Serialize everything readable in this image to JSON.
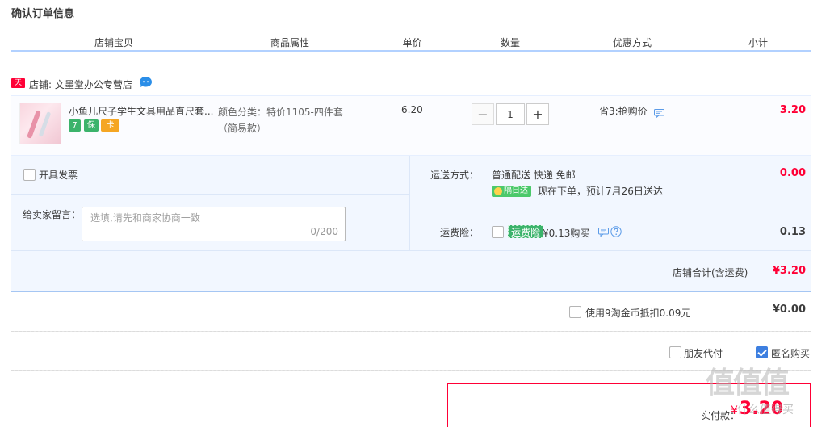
{
  "page_title": "确认订单信息",
  "columns": [
    "店铺宝贝",
    "商品属性",
    "单价",
    "数量",
    "优惠方式",
    "小计"
  ],
  "shop": {
    "badge": "天猫",
    "label": "店铺: 文墨堂办公专营店"
  },
  "item": {
    "title": "小鱼儿尺子学生文具用品直尺套...",
    "service_tags": [
      "7",
      "保",
      "卡"
    ],
    "attr_line1": "颜色分类：特价1105-四件套",
    "attr_line2": "（简易款）",
    "unit_price": "6.20",
    "qty_minus": "−",
    "qty_value": "1",
    "qty_plus": "+",
    "discount": "省3:抢购价",
    "subtotal": "3.20"
  },
  "invoice_label": "开具发票",
  "memo": {
    "label": "给卖家留言：",
    "placeholder": "选填,请先和商家协商一致",
    "counter": "0/200"
  },
  "shipping": {
    "label": "运送方式：",
    "method": "普通配送 快递 免邮",
    "tag": "隔日达",
    "eta": "现在下单，预计7月26日送达",
    "amount": "0.00"
  },
  "insurance": {
    "label": "运费险：",
    "tag": "运费险",
    "price": "¥0.13购买",
    "amount": "0.13"
  },
  "shop_total": {
    "label": "店铺合计(含运费)",
    "amount": "¥3.20"
  },
  "coins": {
    "label": "使用9淘金币抵扣0.09元",
    "amount": "¥0.00"
  },
  "friend_pay_label": "朋友代付",
  "anonymous_label": "匿名购买",
  "anonymous_checked": true,
  "pay": {
    "label": "实付款：",
    "yen": "¥",
    "amount": "3.20"
  },
  "watermark": {
    "main": "值值值",
    "sub": "什么值得买"
  },
  "colors": {
    "accent_red": "#ff0036",
    "header_blue": "#b2d1ff",
    "panel_bg": "#f2f7ff",
    "checkbox_blue": "#3d7fe0"
  }
}
